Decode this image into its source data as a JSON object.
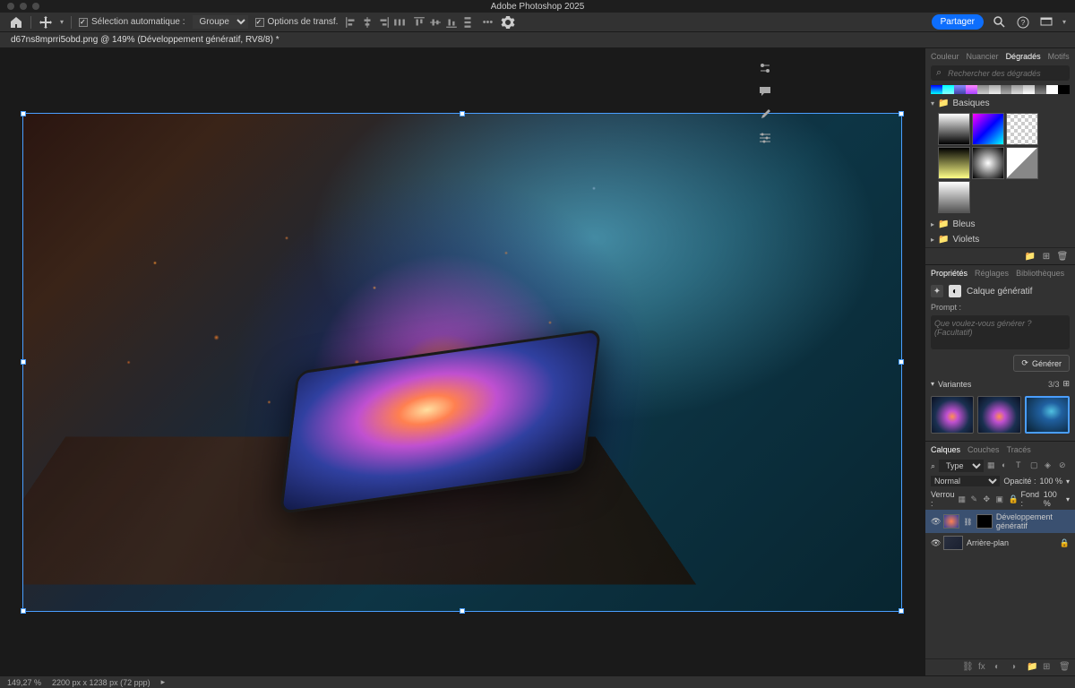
{
  "app_title": "Adobe Photoshop 2025",
  "toolbar": {
    "auto_select_label": "Sélection automatique :",
    "auto_select_mode": "Groupe",
    "transform_label": "Options de transf.",
    "share_label": "Partager"
  },
  "document": {
    "tab_label": "d67ns8mprri5obd.png @ 149% (Développement génératif, RV8/8) *"
  },
  "panels": {
    "color_tabs": {
      "couleur": "Couleur",
      "nuancier": "Nuancier",
      "degrades": "Dégradés",
      "motifs": "Motifs"
    },
    "gradient_search_placeholder": "Rechercher des dégradés",
    "folders": {
      "basiques": "Basiques",
      "bleus": "Bleus",
      "violets": "Violets"
    }
  },
  "properties": {
    "tabs": {
      "proprietes": "Propriétés",
      "reglages": "Réglages",
      "bibliotheques": "Bibliothèques"
    },
    "layer_kind": "Calque génératif",
    "prompt_label": "Prompt :",
    "prompt_placeholder": "Que voulez-vous générer ?  (Facultatif)",
    "generate_label": "Générer",
    "variants_label": "Variantes",
    "variants_count": "3/3"
  },
  "layers": {
    "tabs": {
      "calques": "Calques",
      "couches": "Couches",
      "traces": "Tracés"
    },
    "type_label": "Type",
    "blend_mode": "Normal",
    "opacity_label": "Opacité :",
    "opacity_value": "100 %",
    "lock_label": "Verrou :",
    "fill_label": "Fond :",
    "fill_value": "100 %",
    "items": [
      {
        "name": "Développement génératif"
      },
      {
        "name": "Arrière-plan"
      }
    ]
  },
  "status": {
    "zoom": "149,27 %",
    "dims": "2200 px x 1238 px (72 ppp)"
  },
  "colors": {
    "accent": "#4a9eff",
    "share": "#0d6efd"
  }
}
